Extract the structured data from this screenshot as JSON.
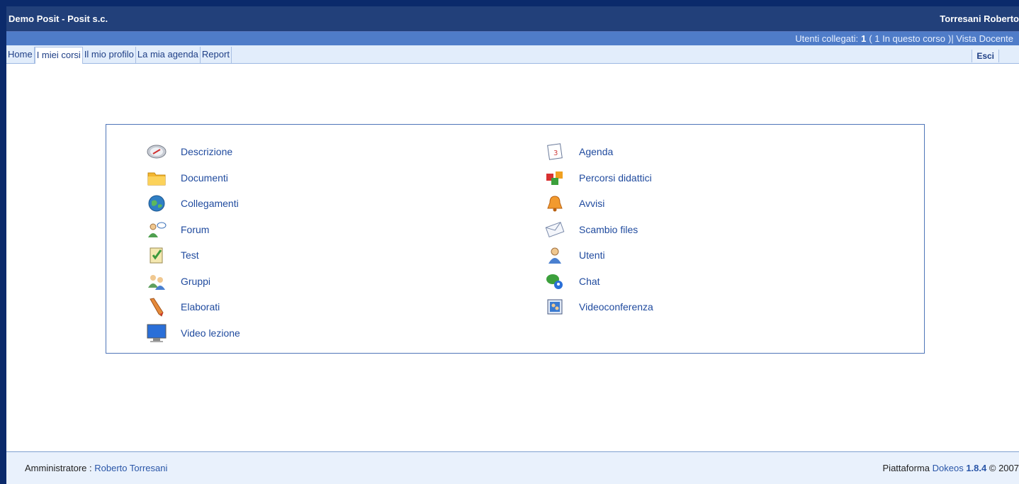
{
  "header": {
    "site_title": "Demo Posit - Posit s.c.",
    "user_name": "Torresani Roberto"
  },
  "status": {
    "online_label": "Utenti collegati:",
    "online_count": "1",
    "course_text": "( 1 In questo corso",
    "view_text": ")| Vista Docente"
  },
  "nav": {
    "tabs": [
      {
        "label": "Home"
      },
      {
        "label": "I miei corsi"
      },
      {
        "label": "Il mio profilo"
      },
      {
        "label": "La mia agenda"
      },
      {
        "label": "Report"
      }
    ],
    "logout": "Esci"
  },
  "tools_left": [
    {
      "label": "Descrizione",
      "icon": "compass-icon"
    },
    {
      "label": "Documenti",
      "icon": "folder-icon"
    },
    {
      "label": "Collegamenti",
      "icon": "globe-icon"
    },
    {
      "label": "Forum",
      "icon": "forum-icon"
    },
    {
      "label": "Test",
      "icon": "quiz-icon"
    },
    {
      "label": "Gruppi",
      "icon": "group-icon"
    },
    {
      "label": "Elaborati",
      "icon": "pencil-icon"
    },
    {
      "label": "Video lezione",
      "icon": "monitor-icon"
    }
  ],
  "tools_right": [
    {
      "label": "Agenda",
      "icon": "calendar-icon"
    },
    {
      "label": "Percorsi didattici",
      "icon": "cubes-icon"
    },
    {
      "label": "Avvisi",
      "icon": "bell-icon"
    },
    {
      "label": "Scambio files",
      "icon": "envelope-icon"
    },
    {
      "label": "Utenti",
      "icon": "user-icon"
    },
    {
      "label": "Chat",
      "icon": "chat-icon"
    },
    {
      "label": "Videoconferenza",
      "icon": "videoconference-icon"
    }
  ],
  "footer": {
    "admin_label": "Amministratore :",
    "admin_name": "Roberto Torresani",
    "platform_label": "Piattaforma",
    "platform_name": "Dokeos",
    "version": "1.8.4",
    "copyright": "© 2007"
  },
  "colors": {
    "header_bg": "#22407a",
    "status_bg": "#4f7cc8",
    "link": "#1f4a9e"
  }
}
